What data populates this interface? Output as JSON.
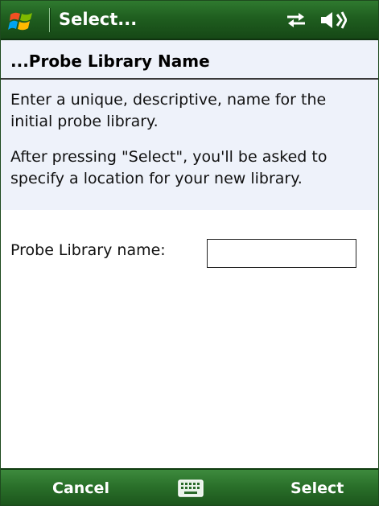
{
  "titlebar": {
    "title": "Select...",
    "icons": [
      "windows-start-icon",
      "connectivity-icon",
      "volume-icon"
    ]
  },
  "header": {
    "title": "...Probe Library Name",
    "description": "Enter a unique, descriptive, name for the initial probe library.",
    "note": "After pressing \"Select\", you'll be asked to specify a location for your new library."
  },
  "form": {
    "label": "Probe Library name:",
    "value": ""
  },
  "softkeys": {
    "left": "Cancel",
    "right": "Select",
    "center_icon": "keyboard-icon"
  },
  "colors": {
    "bar_green": "#1f5e1f",
    "header_bg": "#eef2fa"
  }
}
